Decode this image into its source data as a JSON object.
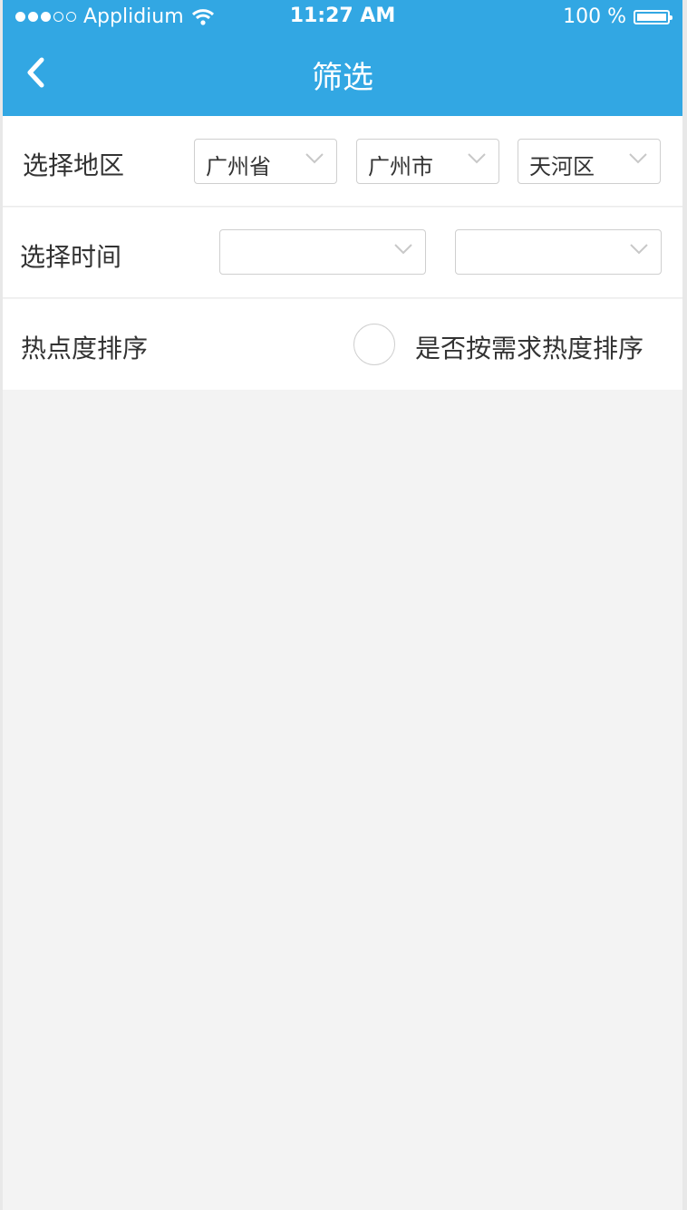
{
  "status_bar": {
    "carrier": "Applidium",
    "time": "11:27 AM",
    "battery": "100 %"
  },
  "nav": {
    "title": "筛选",
    "back_icon": "chevron-left-icon",
    "background_color": "#32a7e3"
  },
  "region": {
    "label": "选择地区",
    "province": "广州省",
    "city": "广州市",
    "district": "天河区"
  },
  "time": {
    "label": "选择时间",
    "start": "",
    "end": ""
  },
  "sort": {
    "label": "热点度排序",
    "option_text": "是否按需求热度排序",
    "checked": false
  },
  "colors": {
    "text": "#333333",
    "border": "#cfcfcf",
    "page_bg": "#f3f3f3"
  }
}
